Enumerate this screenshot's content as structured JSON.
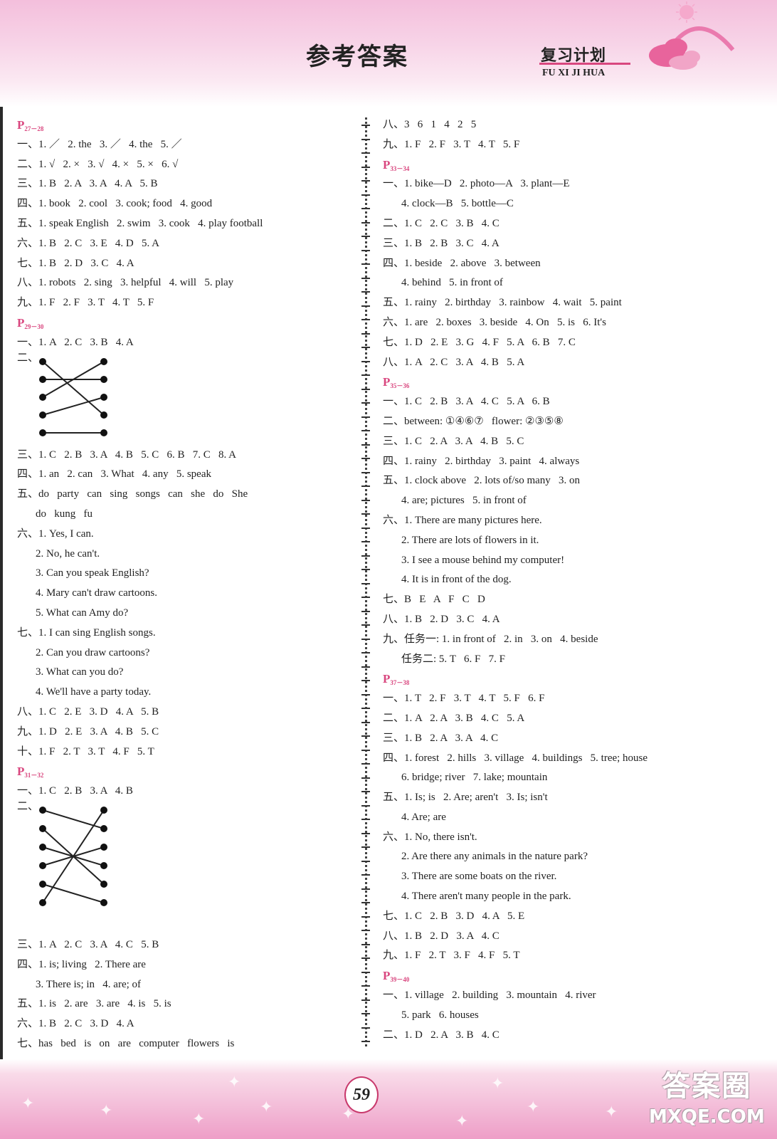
{
  "header": {
    "title": "参考答案",
    "brand_cn": "复习计划",
    "brand_en": "FU XI JI HUA"
  },
  "colors": {
    "accent_pink": "#d9477f",
    "header_bg": "#f4bfdc",
    "footer_bg": "#ee9ec7"
  },
  "left_column": {
    "p27_28": {
      "p": "P",
      "range": "27－28",
      "rows": [
        "一、1. ／   2. the   3. ／   4. the   5. ／",
        "二、1. √   2. ×   3. √   4. ×   5. ×   6. √",
        "三、1. B   2. A   3. A   4. A   5. B",
        "四、1. book   2. cool   3. cook; food   4. good",
        "五、1. speak English   2. swim   3. cook   4. play football",
        "六、1. B   2. C   3. E   4. D   5. A",
        "七、1. B   2. D   3. C   4. A",
        "八、1. robots   2. sing   3. helpful   4. will   5. play",
        "九、1. F   2. F   3. T   4. T   5. F"
      ]
    },
    "p29_30": {
      "p": "P",
      "range": "29－30",
      "row1": "一、1. A   2. C   3. B   4. A",
      "match_label": "二、",
      "match_pairs": [
        [
          1,
          4
        ],
        [
          2,
          2
        ],
        [
          3,
          1
        ],
        [
          4,
          3
        ],
        [
          5,
          5
        ]
      ],
      "match_count": 5,
      "rows_after": [
        "三、1. C   2. B   3. A   4. B   5. C   6. B   7. C   8. A",
        "四、1. an   2. can   3. What   4. any   5. speak",
        "五、do   party   can   sing   songs   can   she   do   She"
      ],
      "row_5_cont": "do   kung   fu",
      "row_6": "六、1. Yes, I can.",
      "row_6_sub": [
        "2. No, he can't.",
        "3. Can you speak English?",
        "4. Mary can't draw cartoons.",
        "5. What can Amy do?"
      ],
      "row_7": "七、1. I can sing English songs.",
      "row_7_sub": [
        "2. Can you draw cartoons?",
        "3. What can you do?",
        "4. We'll have a party today."
      ],
      "rows_end": [
        "八、1. C   2. E   3. D   4. A   5. B",
        "九、1. D   2. E   3. A   4. B   5. C",
        "十、1. F   2. T   3. T   4. F   5. T"
      ]
    },
    "p31_32": {
      "p": "P",
      "range": "31－32",
      "row1": "一、1. C   2. B   3. A   4. B",
      "match_label": "二、",
      "match_pairs": [
        [
          1,
          2
        ],
        [
          2,
          5
        ],
        [
          3,
          4
        ],
        [
          4,
          3
        ],
        [
          5,
          6
        ],
        [
          6,
          1
        ]
      ],
      "match_count": 6,
      "rows_after": [
        "三、1. A   2. C   3. A   4. C   5. B",
        "四、1. is; living   2. There are"
      ],
      "row_4_cont": "3. There is; in   4. are; of",
      "rows_end": [
        "五、1. is   2. are   3. are   4. is   5. is",
        "六、1. B   2. C   3. D   4. A",
        "七、has   bed   is   on   are   computer   flowers   is"
      ]
    }
  },
  "right_column": {
    "cont_rows": [
      "八、3   6   1   4   2   5",
      "九、1. F   2. F   3. T   4. T   5. F"
    ],
    "p33_34": {
      "p": "P",
      "range": "33－34",
      "rows": [
        {
          "t": "一、1. bike—D   2. photo—A   3. plant—E",
          "indent": false
        },
        {
          "t": "4. clock—B   5. bottle—C",
          "indent": true
        },
        {
          "t": "二、1. C   2. C   3. B   4. C",
          "indent": false
        },
        {
          "t": "三、1. B   2. B   3. C   4. A",
          "indent": false
        },
        {
          "t": "四、1. beside   2. above   3. between",
          "indent": false
        },
        {
          "t": "4. behind   5. in front of",
          "indent": true
        },
        {
          "t": "五、1. rainy   2. birthday   3. rainbow   4. wait   5. paint",
          "indent": false
        },
        {
          "t": "六、1. are   2. boxes   3. beside   4. On   5. is   6. It's",
          "indent": false
        },
        {
          "t": "七、1. D   2. E   3. G   4. F   5. A   6. B   7. C",
          "indent": false
        },
        {
          "t": "八、1. A   2. C   3. A   4. B   5. A",
          "indent": false
        }
      ]
    },
    "p35_36": {
      "p": "P",
      "range": "35－36",
      "rows": [
        {
          "t": "一、1. C   2. B   3. A   4. C   5. A   6. B",
          "indent": false
        },
        {
          "t": "二、between: ①④⑥⑦   flower: ②③⑤⑧",
          "indent": false
        },
        {
          "t": "三、1. C   2. A   3. A   4. B   5. C",
          "indent": false
        },
        {
          "t": "四、1. rainy   2. birthday   3. paint   4. always",
          "indent": false
        },
        {
          "t": "五、1. clock above   2. lots of/so many   3. on",
          "indent": false
        },
        {
          "t": "4. are; pictures   5. in front of",
          "indent": true
        },
        {
          "t": "六、1. There are many pictures here.",
          "indent": false
        },
        {
          "t": "2. There are lots of flowers in it.",
          "indent": true
        },
        {
          "t": "3. I see a mouse behind my computer!",
          "indent": true
        },
        {
          "t": "4. It is in front of the dog.",
          "indent": true
        },
        {
          "t": "七、B   E   A   F   C   D",
          "indent": false
        },
        {
          "t": "八、1. B   2. D   3. C   4. A",
          "indent": false
        },
        {
          "t": "九、任务一: 1. in front of   2. in   3. on   4. beside",
          "indent": false
        },
        {
          "t": "任务二: 5. T   6. F   7. F",
          "indent": true
        }
      ]
    },
    "p37_38": {
      "p": "P",
      "range": "37－38",
      "rows": [
        {
          "t": "一、1. T   2. F   3. T   4. T   5. F   6. F",
          "indent": false
        },
        {
          "t": "二、1. A   2. A   3. B   4. C   5. A",
          "indent": false
        },
        {
          "t": "三、1. B   2. A   3. A   4. C",
          "indent": false
        },
        {
          "t": "四、1. forest   2. hills   3. village   4. buildings   5. tree; house",
          "indent": false
        },
        {
          "t": "6. bridge; river   7. lake; mountain",
          "indent": true
        },
        {
          "t": "五、1. Is; is   2. Are; aren't   3. Is; isn't",
          "indent": false
        },
        {
          "t": "4. Are; are",
          "indent": true
        },
        {
          "t": "六、1. No, there isn't.",
          "indent": false
        },
        {
          "t": "2. Are there any animals in the nature park?",
          "indent": true
        },
        {
          "t": "3. There are some boats on the river.",
          "indent": true
        },
        {
          "t": "4. There aren't many people in the park.",
          "indent": true
        },
        {
          "t": "七、1. C   2. B   3. D   4. A   5. E",
          "indent": false
        },
        {
          "t": "八、1. B   2. D   3. A   4. C",
          "indent": false
        },
        {
          "t": "九、1. F   2. T   3. F   4. F   5. T",
          "indent": false
        }
      ]
    },
    "p39_40": {
      "p": "P",
      "range": "39－40",
      "rows": [
        {
          "t": "一、1. village   2. building   3. mountain   4. river",
          "indent": false
        },
        {
          "t": "5. park   6. houses",
          "indent": true
        },
        {
          "t": "二、1. D   2. A   3. B   4. C",
          "indent": false
        }
      ]
    }
  },
  "footer": {
    "page_number": "59",
    "watermark_cn": "答案圈",
    "watermark_en": "MXQE.COM"
  }
}
